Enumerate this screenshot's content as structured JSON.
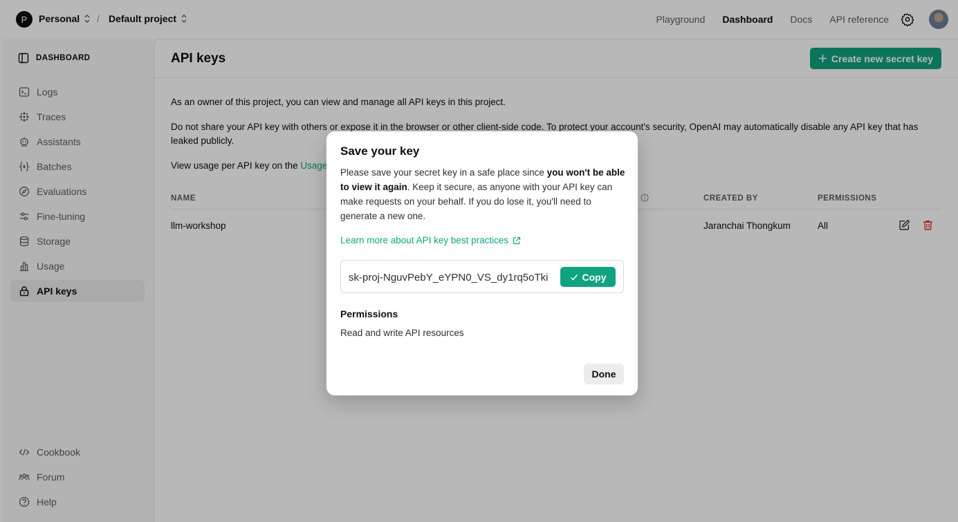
{
  "header": {
    "org_initial": "P",
    "org_name": "Personal",
    "separator": "/",
    "project_name": "Default project",
    "nav": [
      "Playground",
      "Dashboard",
      "Docs",
      "API reference"
    ],
    "active_nav": "Dashboard"
  },
  "sidebar": {
    "title": "DASHBOARD",
    "items": [
      {
        "label": "Logs",
        "icon": "terminal-icon"
      },
      {
        "label": "Traces",
        "icon": "traces-icon"
      },
      {
        "label": "Assistants",
        "icon": "robot-icon"
      },
      {
        "label": "Batches",
        "icon": "braces-icon"
      },
      {
        "label": "Evaluations",
        "icon": "compass-icon"
      },
      {
        "label": "Fine-tuning",
        "icon": "sliders-icon"
      },
      {
        "label": "Storage",
        "icon": "database-icon"
      },
      {
        "label": "Usage",
        "icon": "bar-chart-icon"
      },
      {
        "label": "API keys",
        "icon": "lock-icon"
      }
    ],
    "active_item": "API keys",
    "footer": [
      {
        "label": "Cookbook",
        "icon": "code-icon"
      },
      {
        "label": "Forum",
        "icon": "users-icon"
      },
      {
        "label": "Help",
        "icon": "help-icon"
      }
    ]
  },
  "main": {
    "title": "API keys",
    "create_button": "Create new secret key",
    "para1": "As an owner of this project, you can view and manage all API keys in this project.",
    "para2": "Do not share your API key with others or expose it in the browser or other client-side code. To protect your account's security, OpenAI may automatically disable any API key that has leaked publicly.",
    "para3_prefix": "View usage per API key on the ",
    "para3_link": "Usage",
    "columns": {
      "name": "NAME",
      "created_by": "CREATED BY",
      "permissions": "PERMISSIONS"
    },
    "rows": [
      {
        "name": "llm-workshop",
        "created_by": "Jaranchai Thongkum",
        "permissions": "All"
      }
    ]
  },
  "modal": {
    "title": "Save your key",
    "body_start": "Please save your secret key in a safe place since ",
    "body_bold": "you won't be able to view it again",
    "body_end": ". Keep it secure, as anyone with your API key can make requests on your behalf. If you do lose it, you'll need to generate a new one.",
    "link": "Learn more about API key best practices",
    "key_value": "sk-proj-NguvPebY_eYPN0_VS_dy1rq5oTki",
    "copy_label": "Copy",
    "permissions_label": "Permissions",
    "permissions_value": "Read and write API resources",
    "done_label": "Done"
  },
  "colors": {
    "accent": "#10a37f",
    "danger": "#e02e2a"
  }
}
